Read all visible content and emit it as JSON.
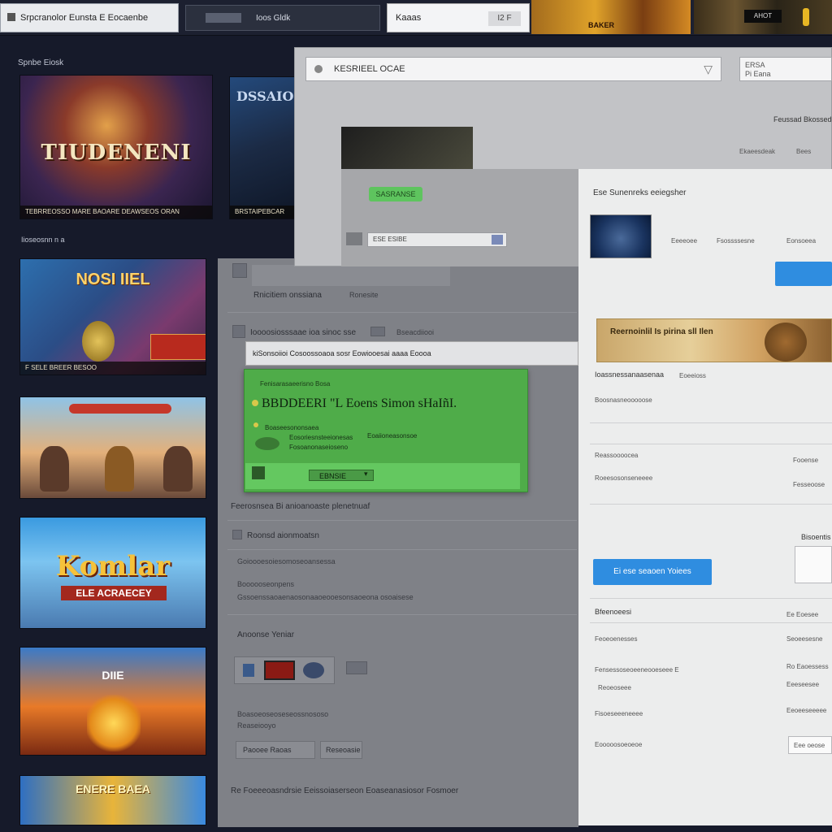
{
  "browser": {
    "tab1_label": "Srpcranolor  Eunsta  E  Eocaenbe",
    "tab2_label": "Ioos  Gldk",
    "tab3_label": "Kaaas",
    "tab3_badge": "I2 F",
    "banner1_text": "BAKER",
    "banner2_chip": "AHOT"
  },
  "store": {
    "section1": "Spnbe Eiosk",
    "section2": "Iioseosnn n a",
    "card1_title": "TIUDENENI",
    "card1_caption": "TEBRREOSSO  MARE  BAOARE  DEAWSEOS  ORAN",
    "card2_title": "DSSAIO",
    "card2_caption": "BRSTAIPEBCAR",
    "card3_title": "NOSI IIEL",
    "card3_caption": "F  SELE  BREER  BESOO",
    "card5_title": "Komlar",
    "card5_sub": "ELE ACRAECEY",
    "card6_title": "DIIE",
    "card7_title": "ENERE  BAEA"
  },
  "dialog": {
    "address": "KESRIEEL  OCAE",
    "side_line1": "ERSA",
    "side_line2": "Pi Eana",
    "green_pill": "SASRANSE",
    "search_text": "ESE  ESIBE",
    "top_right_1": "Feussad  Bkossed",
    "top_right_2": "Ekaeesdeak",
    "top_right_3": "Bees"
  },
  "middle": {
    "row1": "Rnicitiem onssiana",
    "row1_extra": "Ronesite",
    "row2": "Ioooosiosssaae  ioa  sinoc  sse",
    "row2_extra": "Bseacdiiooi",
    "bar": "kiSonsoiioi  Cosoossoaoa  sosr  Eowiooesai  aaaa  Eoooa",
    "row3": "Feerosnsea  Bi  anioanoaste  plenetnuaf",
    "row4": "Roonsd  aionmoatsn",
    "row5": "Goioooesoiesomoseoansessa",
    "row6": "Boooooseonpens",
    "row7": "Gssoenssaoaenaosonaaoeooesonsaoeona  osoaisese",
    "row8": "Anoonse  Yeniar",
    "row9": "Boasoeoseoseseossnososo",
    "row9b": "Reaseiooyo",
    "row10": "Paooee  Raoas",
    "row10b": "Reseoasie",
    "row11": "Re  Foeeeoasndrsie  Eeissoiaserseon  Eoaseanasiosor  Fosmoer"
  },
  "green_modal": {
    "subtitle": "Fenisarasaeerisno  Bosa",
    "title": "BBDDEERI  \"L  Eoens  Simon  sHaIñI.",
    "line1": "Boaseesononsaea",
    "line2": "Eosoriesnsteeionesas",
    "line3": "Eoaiioneasonsoe",
    "line4": "Fosoanonaseioseno",
    "select_value": "EBNSIE"
  },
  "right": {
    "header": "Ese  Sunenreks  eeiegsher",
    "map_row_1": "Eeeeoee",
    "map_row_2": "Fsossssesne",
    "map_row_3": "Eonsoeea",
    "banner_text": "Reernoinlil  Is  pirina  sll  Ilen",
    "label1": "Ioassnessanaasenaa",
    "label1_side": "Eoeeioss",
    "label2": "Boosnasneooooose",
    "label3": "Reassoooocea",
    "label3_side": "Fooense",
    "label4": "Roeesosonseneeee",
    "label4_side": "Fesseoose",
    "side_label": "Bisoentis",
    "blue_button": "Ei  ese  seaoen  Yoiees",
    "list_header": "Bfeenoeesi",
    "list_header_side": "Ee  Eoesee",
    "list1": "Feoeoenesses",
    "list1_side": "Seoeesesne",
    "list2": "Fensessoseoeeneooeseee  E",
    "list2_side": "Ro  Eaoessess",
    "list2_b": "Reoeoseee",
    "list2_b_side": "Eeeseesee",
    "list3": "Fisoeseeeneeee",
    "list3_side": "Eeoeeseeeee",
    "list4": "Eooooosoeoeoe",
    "list4_side": "Eee  oeose"
  }
}
